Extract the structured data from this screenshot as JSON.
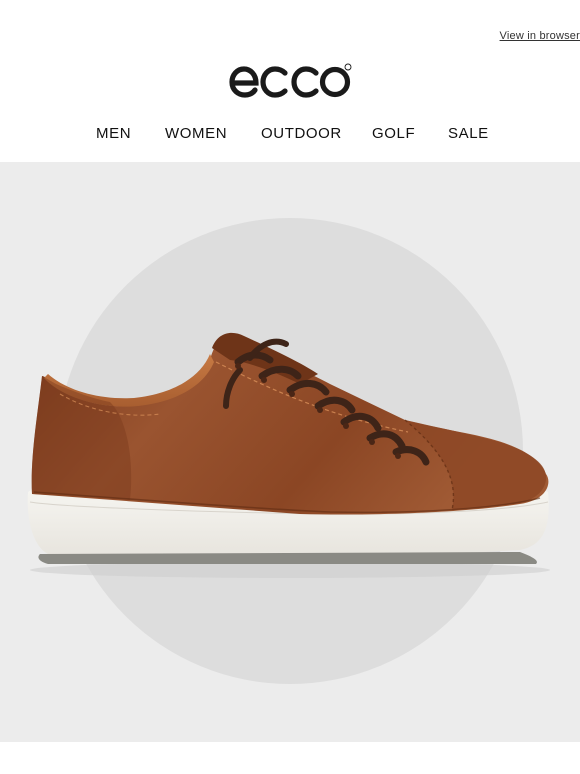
{
  "header": {
    "view_in_browser": "View in browser",
    "brand": "ecco"
  },
  "nav": {
    "items": [
      {
        "label": "MEN"
      },
      {
        "label": "WOMEN"
      },
      {
        "label": "OUTDOOR"
      },
      {
        "label": "GOLF"
      },
      {
        "label": "SALE"
      }
    ]
  },
  "hero": {
    "image": "brown-leather-sneaker-photo",
    "colors": {
      "background": "#ececec",
      "circle": "#dddddd",
      "leather": "#8b4a26",
      "sole": "#f2f0ec"
    }
  }
}
